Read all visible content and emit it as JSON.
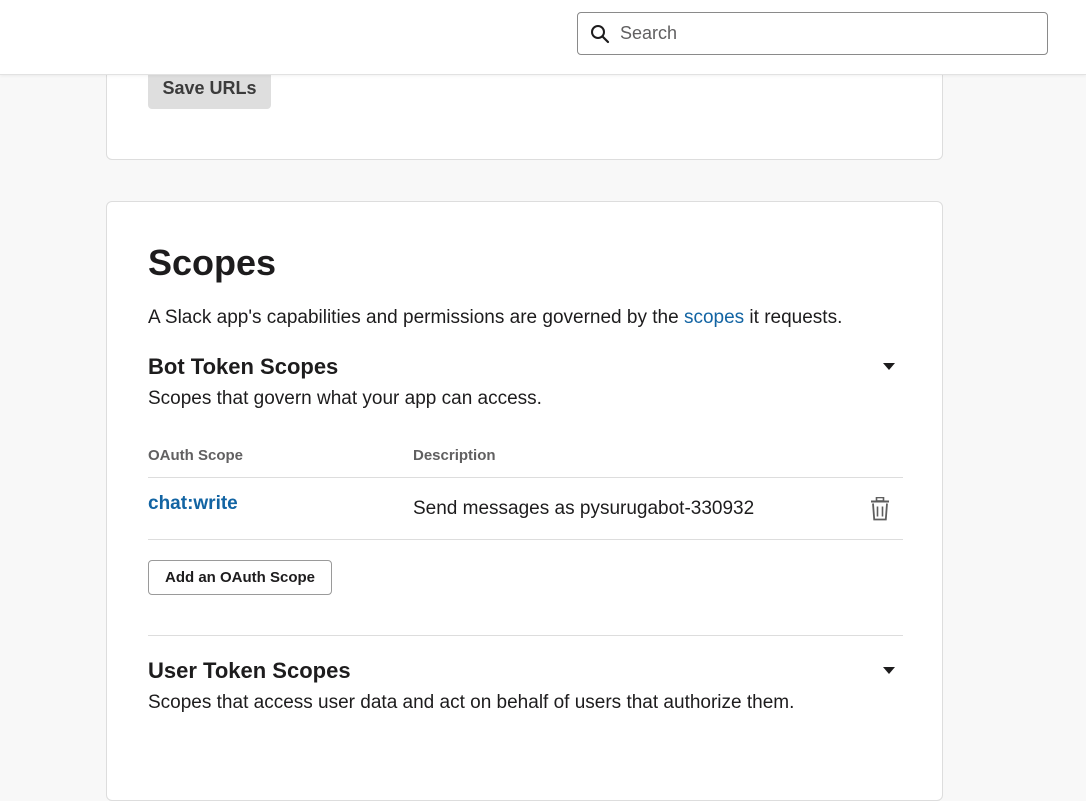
{
  "search": {
    "placeholder": "Search",
    "value": ""
  },
  "redirect_urls": {
    "save_label": "Save URLs"
  },
  "scopes": {
    "title": "Scopes",
    "intro_before": "A Slack app's capabilities and permissions are governed by the ",
    "intro_link": "scopes",
    "intro_after": " it requests.",
    "bot": {
      "heading": "Bot Token Scopes",
      "subtitle": "Scopes that govern what your app can access.",
      "columns": [
        "OAuth Scope",
        "Description"
      ],
      "rows": [
        {
          "scope": "chat:write",
          "description": "Send messages as pysurugabot-330932"
        }
      ],
      "add_label": "Add an OAuth Scope"
    },
    "user": {
      "heading": "User Token Scopes",
      "subtitle": "Scopes that access user data and act on behalf of users that authorize them."
    }
  },
  "icons": {
    "search": "search-icon",
    "caret": "caret-down-icon",
    "delete": "trash-icon"
  },
  "colors": {
    "link": "#1264a3",
    "text": "#1d1c1d",
    "muted": "#616061"
  }
}
